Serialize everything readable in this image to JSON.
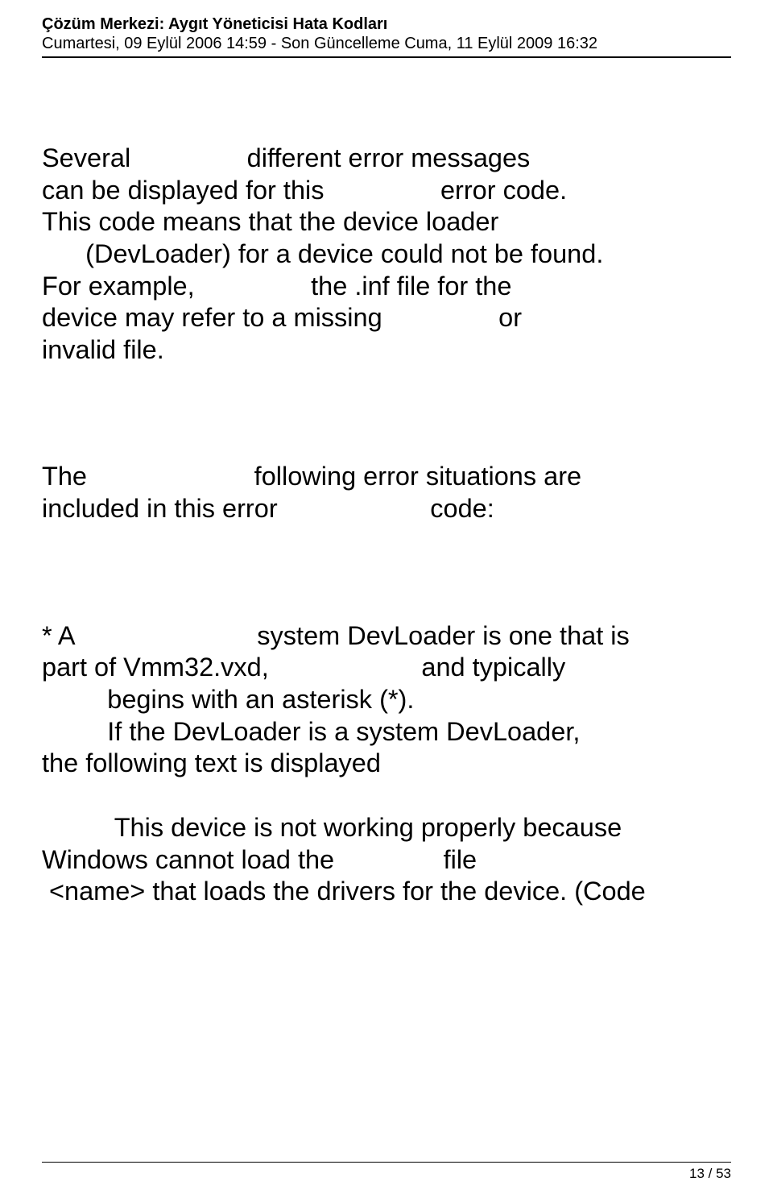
{
  "header": {
    "title": "Çözüm Merkezi: Aygıt Yöneticisi Hata Kodları",
    "meta": "Cumartesi, 09 Eylül 2006 14:59 - Son Güncelleme Cuma, 11 Eylül 2009 16:32"
  },
  "body": {
    "p1_l1": "Several                different error messages",
    "p1_l2": "can be displayed for this                error code.",
    "p1_l3": "This code means that the device loader",
    "p1_l4": "      (DevLoader) for a device could not be found.",
    "p1_l5": "For example,                the .inf file for the",
    "p1_l6": "device may refer to a missing                or",
    "p1_l7": "invalid file.",
    "p2_l1": "The                       following error situations are",
    "p2_l2": "included in this error                     code:",
    "p3_l1": "* A                         system DevLoader is one that is",
    "p3_l2": "part of Vmm32.vxd,                     and typically",
    "p3_l3": "         begins with an asterisk (*).",
    "p3_l4": "         If the DevLoader is a system DevLoader,",
    "p3_l5": "the following text is displayed",
    "p4_l1": "          This device is not working properly because",
    "p4_l2": "Windows cannot load the               file",
    "p4_l3": " <name> that loads the drivers for the device. (Code"
  },
  "footer": {
    "page": "13 / 53"
  }
}
